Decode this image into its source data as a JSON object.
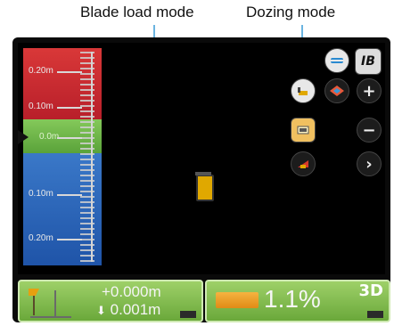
{
  "callouts": {
    "blade_load_mode": "Blade load mode",
    "dozing_mode": "Dozing mode"
  },
  "grade_scale": {
    "labels": [
      "0.20m",
      "0.10m",
      "0.0m",
      "0.10m",
      "0.20m"
    ],
    "colors": {
      "above": "#c8283a",
      "on_grade": "#6ab347",
      "below": "#2e66b8"
    }
  },
  "icons": {
    "top_right_1": "surface-view-icon",
    "top_right_2": "ib-text",
    "dozing_mode": "dozing-mode-icon",
    "plan_view": "plan-view-icon",
    "zoom_in": "plus-icon",
    "blade_load_mode": "blade-load-icon",
    "zoom_out": "minus-icon",
    "next": "chevron-right-icon",
    "dozer": "dozer-icon"
  },
  "top_right_label": "IB",
  "zoom_in_label": "+",
  "zoom_out_label": "−",
  "next_label": "›",
  "bottom_left": {
    "elevation": "+0.000m",
    "cut_fill": "0.001m",
    "cut_fill_arrow": "⬇"
  },
  "bottom_right": {
    "slope": "1.1%",
    "mode": "3D"
  }
}
